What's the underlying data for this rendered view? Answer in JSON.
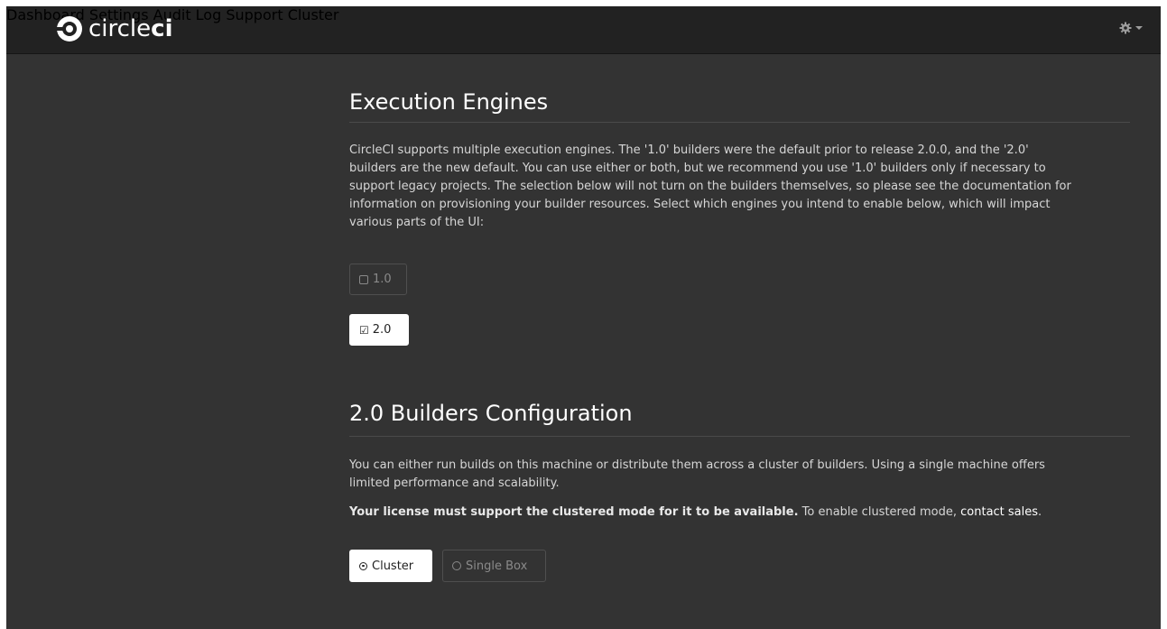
{
  "navbar": {
    "logo_light": "circle",
    "logo_bold": "ci",
    "links": [
      "Dashboard",
      "Settings",
      "Audit Log",
      "Support",
      "Cluster"
    ],
    "settings_icon": "gear-icon"
  },
  "engines": {
    "title": "Execution Engines",
    "description": "CircleCI supports multiple execution engines. The '1.0' builders were the default prior to release 2.0.0, and the '2.0' builders are the new default. You can use either or both, but we recommend you use '1.0' builders only if necessary to support legacy projects. The selection below will not turn on the builders themselves, so please see the documentation for information on provisioning your builder resources. Select which engines you intend to enable below, which will impact various parts of the UI:",
    "option_1": {
      "label": "1.0",
      "checked": false
    },
    "option_2": {
      "label": "2.0",
      "checked": true
    }
  },
  "builders": {
    "title": "2.0 Builders Configuration",
    "description": "You can either run builds on this machine or distribute them across a cluster of builders. Using a single machine offers limited performance and scalability.",
    "license_bold": "Your license must support the clustered mode for it to be available.",
    "license_rest": " To enable clustered mode, ",
    "contact_link": "contact sales",
    "license_end": ".",
    "option_cluster": {
      "label": "Cluster",
      "selected": true
    },
    "option_single": {
      "label": "Single Box",
      "selected": false
    }
  },
  "colors": {
    "navbar_bg": "#222222",
    "page_bg": "#333333",
    "nav_text": "#9d9d9d",
    "button_active_bg": "#ffffff"
  }
}
